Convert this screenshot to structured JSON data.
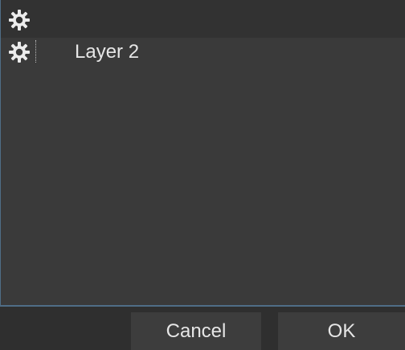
{
  "layers": {
    "header_icon": "gear-icon",
    "items": [
      {
        "name": "Layer 2",
        "icon": "gear-icon"
      }
    ]
  },
  "buttons": {
    "cancel_label": "Cancel",
    "ok_label": "OK"
  },
  "colors": {
    "panel_background": "#3a3a3a",
    "header_row": "#323232",
    "footer_background": "#2f2f2f",
    "button_background": "#3d3d3d",
    "accent_border": "#4f6d86",
    "text": "#e6e6e6"
  }
}
